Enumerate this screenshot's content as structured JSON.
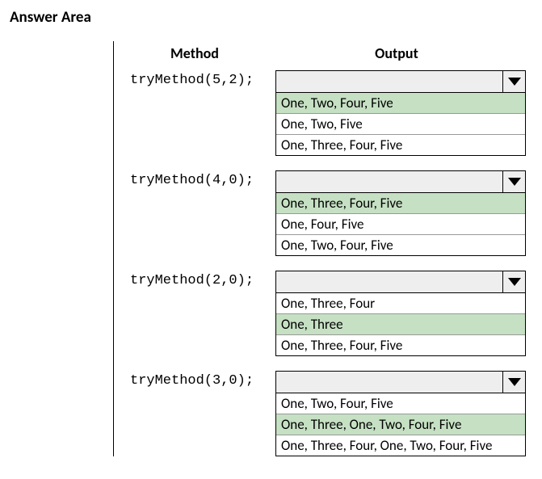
{
  "title": "Answer Area",
  "headers": {
    "method": "Method",
    "output": "Output"
  },
  "rows": [
    {
      "method": "tryMethod(5,2);",
      "highlighted_index": 0,
      "options": [
        "One, Two, Four, Five",
        "One, Two, Five",
        "One, Three, Four, Five"
      ]
    },
    {
      "method": "tryMethod(4,0);",
      "highlighted_index": 0,
      "options": [
        "One, Three, Four, Five",
        "One, Four, Five",
        "One, Two, Four, Five"
      ]
    },
    {
      "method": "tryMethod(2,0);",
      "highlighted_index": 1,
      "options": [
        "One, Three, Four",
        "One, Three",
        "One, Three, Four, Five"
      ]
    },
    {
      "method": "tryMethod(3,0);",
      "highlighted_index": 1,
      "options": [
        "One, Two, Four, Five",
        "One, Three, One, Two, Four, Five",
        "One, Three, Four, One, Two, Four, Five"
      ]
    }
  ]
}
